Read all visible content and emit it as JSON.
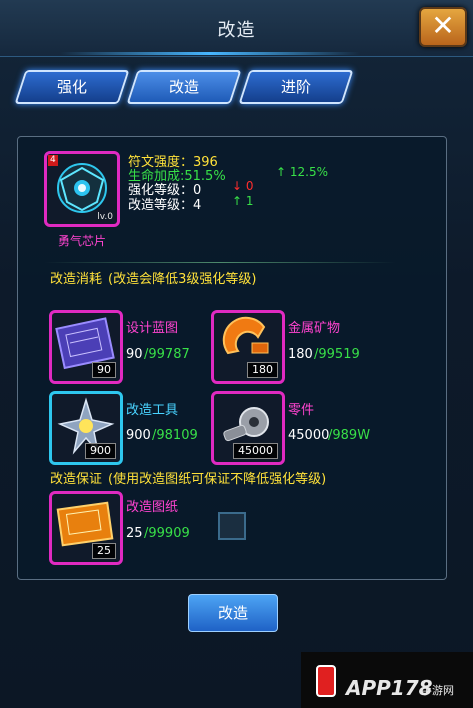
{
  "window": {
    "title": "改造",
    "close_label": "✕"
  },
  "tabs": [
    {
      "label": "强化"
    },
    {
      "label": "改造"
    },
    {
      "label": "进阶"
    }
  ],
  "item": {
    "badge": "4",
    "level": "lv.0",
    "name": "勇气芯片",
    "rune_strength": "符文强度：396",
    "life_bonus": "生命加成:51.5%",
    "life_bonus_up": "↑ 12.5%",
    "enhance_level": "强化等级：0",
    "enhance_level_change": "↓ 0",
    "remodel_level": "改造等级：4",
    "remodel_level_change": "↑ 1"
  },
  "consumption": {
    "heading": "改造消耗",
    "note": "(改造会降低3级强化等级)",
    "materials": [
      {
        "name": "设计蓝图",
        "count": "90",
        "have": "90",
        "total": "/99787",
        "icon": "blueprint-icon"
      },
      {
        "name": "金属矿物",
        "count": "180",
        "have": "180",
        "total": "/99519",
        "icon": "metal-ore-icon"
      },
      {
        "name": "改造工具",
        "count": "900",
        "have": "900",
        "total": "/98109",
        "icon": "remodel-tool-icon"
      },
      {
        "name": "零件",
        "count": "45000",
        "have": "45000",
        "total": "/989W",
        "icon": "parts-icon"
      }
    ]
  },
  "guarantee": {
    "heading": "改造保证",
    "note": "(使用改造图纸可保证不降低强化等级)",
    "material": {
      "name": "改造图纸",
      "count": "25",
      "have": "25",
      "total": "/99909",
      "icon": "remodel-scroll-icon"
    }
  },
  "action": {
    "label": "改造"
  },
  "watermark": {
    "brand": "APP178",
    "site": "手游网"
  }
}
